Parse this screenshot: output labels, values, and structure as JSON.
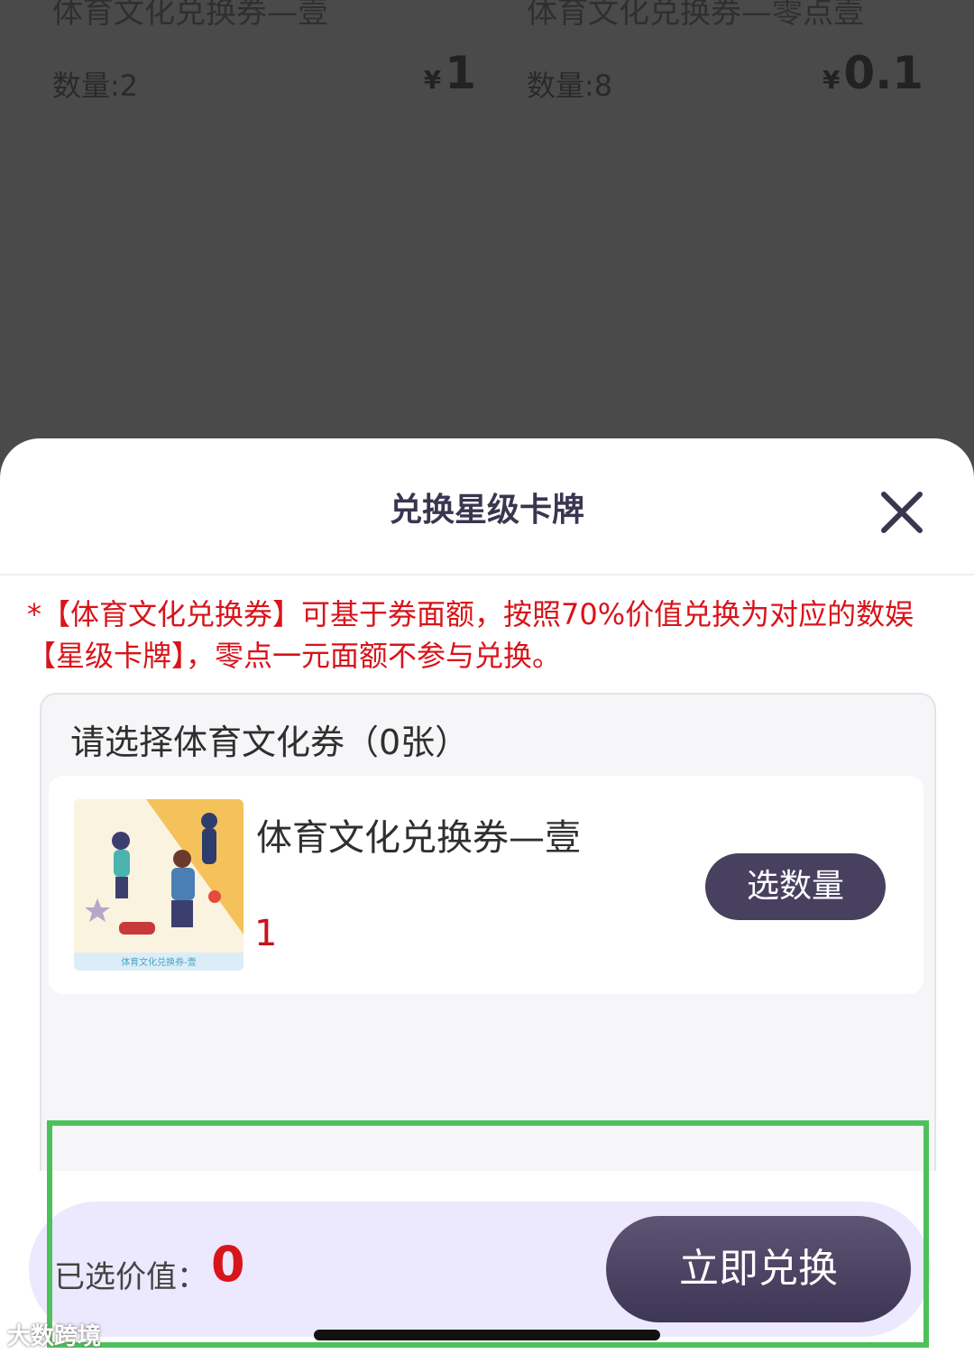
{
  "background_cards": [
    {
      "title": "体育文化兑换券—壹",
      "qty": "数量:2",
      "currency": "¥",
      "price": "1"
    },
    {
      "title": "体育文化兑换券—零点壹",
      "qty": "数量:8",
      "currency": "¥",
      "price": "0.1"
    }
  ],
  "sheet": {
    "title": "兑换星级卡牌",
    "notice": "*【体育文化兑换券】可基于券面额，按照70%价值兑换为对应的数娱【星级卡牌】，零点一元面额不参与兑换。",
    "panel_title": "请选择体育文化券（0张）",
    "item": {
      "name": "体育文化兑换券—壹",
      "count": "1",
      "select_label": "选数量",
      "thumb_caption": "体育文化兑换券-壹"
    },
    "footer": {
      "value_label": "已选价值：",
      "value": "0",
      "redeem_label": "立即兑换"
    }
  },
  "watermark": "大数跨境",
  "colors": {
    "accent": "#48405f",
    "alert": "#d8141b",
    "highlight": "#4cc15a",
    "bar": "#ece8fd"
  }
}
